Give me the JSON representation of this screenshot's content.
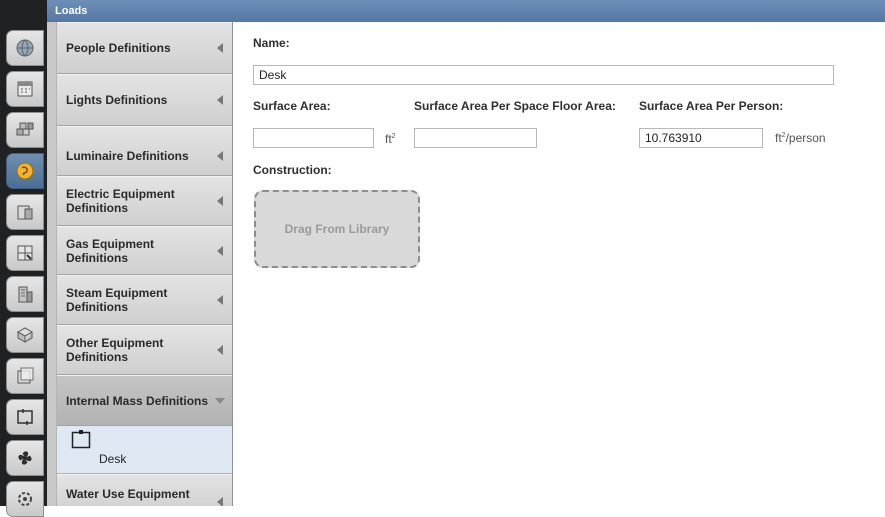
{
  "window": {
    "title": "Loads"
  },
  "tabs": [
    {
      "icon": "globe-icon",
      "active": false
    },
    {
      "icon": "calendar-icon",
      "active": false
    },
    {
      "icon": "building-blocks-icon",
      "active": false
    },
    {
      "icon": "loads-icon",
      "active": true
    },
    {
      "icon": "space-types-icon",
      "active": false
    },
    {
      "icon": "geometry-icon",
      "active": false
    },
    {
      "icon": "facility-icon",
      "active": false
    },
    {
      "icon": "spaces-icon",
      "active": false
    },
    {
      "icon": "thermal-zones-icon",
      "active": false
    },
    {
      "icon": "hvac-systems-icon",
      "active": false
    },
    {
      "icon": "fan-icon",
      "active": false
    },
    {
      "icon": "settings-icon",
      "active": false
    }
  ],
  "categories": [
    {
      "label": "People Definitions"
    },
    {
      "label": "Lights Definitions"
    },
    {
      "label": "Luminaire Definitions"
    },
    {
      "label": "Electric Equipment Definitions"
    },
    {
      "label": "Gas Equipment Definitions"
    },
    {
      "label": "Steam Equipment Definitions"
    },
    {
      "label": "Other Equipment Definitions"
    },
    {
      "label": "Internal Mass Definitions",
      "expanded": true
    },
    {
      "label": "Water Use Equipment"
    }
  ],
  "selected_item": {
    "label": "Desk",
    "icon": "internal-mass-icon"
  },
  "form": {
    "name_label": "Name:",
    "name_value": "Desk",
    "surface_area_label": "Surface Area:",
    "surface_area_value": "",
    "surface_area_unit": "ft",
    "surface_area_unit_exp": "2",
    "per_floor_label": "Surface Area Per Space Floor Area:",
    "per_floor_value": "",
    "per_person_label": "Surface Area Per Person:",
    "per_person_value": "10.763910",
    "per_person_unit_pre": "ft",
    "per_person_unit_exp": "2",
    "per_person_unit_post": "/person",
    "construction_label": "Construction:",
    "drop_label": "Drag From Library"
  },
  "colors": {
    "title_bar": "#5f81ad",
    "active_tab": "#5a7aa0",
    "selected_item_bg": "#dde8f3"
  }
}
